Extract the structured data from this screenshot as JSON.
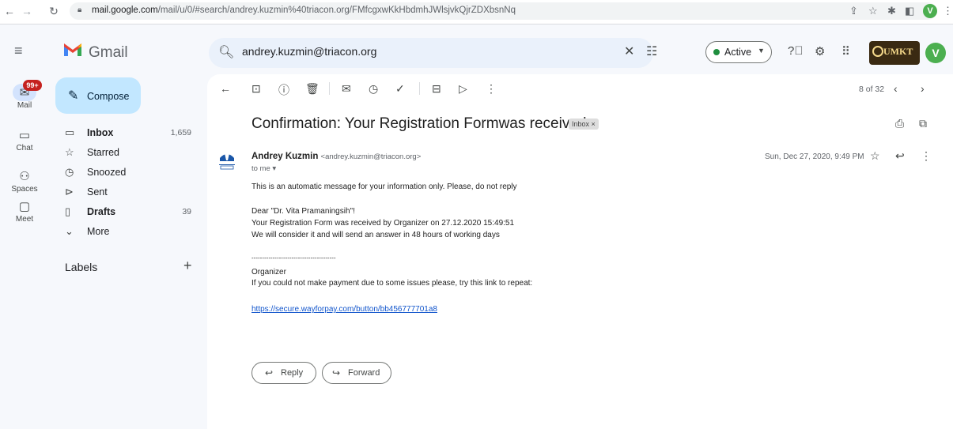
{
  "browser": {
    "url_host": "mail.google.com",
    "url_path": "/mail/u/0/#search/andrey.kuzmin%40triacon.org/FMfcgxwKkHbdmhJWlsjvkQjrZDXbsnNq",
    "profile_initial": "V"
  },
  "header": {
    "app_name": "Gmail",
    "search_value": "andrey.kuzmin@triacon.org",
    "status_label": "Active",
    "org_logo_text": "UMKT",
    "avatar_initial": "V"
  },
  "rail": {
    "badge": "99+",
    "items": [
      {
        "label": "Mail",
        "icon": "mail-icon"
      },
      {
        "label": "Chat",
        "icon": "chat-icon"
      },
      {
        "label": "Spaces",
        "icon": "spaces-icon"
      },
      {
        "label": "Meet",
        "icon": "meet-icon"
      }
    ]
  },
  "sidebar": {
    "compose_label": "Compose",
    "items": [
      {
        "label": "Inbox",
        "count": "1,659",
        "icon": "inbox-icon"
      },
      {
        "label": "Starred",
        "count": "",
        "icon": "star-icon"
      },
      {
        "label": "Snoozed",
        "count": "",
        "icon": "clock-icon"
      },
      {
        "label": "Sent",
        "count": "",
        "icon": "send-icon"
      },
      {
        "label": "Drafts",
        "count": "39",
        "icon": "draft-icon"
      },
      {
        "label": "More",
        "count": "",
        "icon": "chevron-down-icon"
      }
    ],
    "labels_title": "Labels"
  },
  "toolbar": {
    "paging": "8 of 32"
  },
  "email": {
    "subject": "Confirmation: Your Registration Formwas received.",
    "label_chip": "Inbox ×",
    "sender_name": "Andrey Kuzmin",
    "sender_email": "<andrey.kuzmin@triacon.org>",
    "to_line": "to me ▾",
    "date": "Sun, Dec 27, 2020, 9:49 PM",
    "body": {
      "line1": "This is an automatic message for your information only. Please, do not reply",
      "line2": "Dear \"Dr. Vita Pramaningsih\"!",
      "line3": "Your Registration Form was received by Organizer on 27.12.2020 15:49:51",
      "line4": "We will consider it and will send an answer in 48 hours of working days",
      "separator": "----------------------------------------",
      "line5": "Organizer",
      "line6": "If you could not make payment due to some issues please, try this link to repeat:",
      "link": "https://secure.wayforpay.com/button/bb456777701a8"
    },
    "reply_label": "Reply",
    "forward_label": "Forward"
  }
}
